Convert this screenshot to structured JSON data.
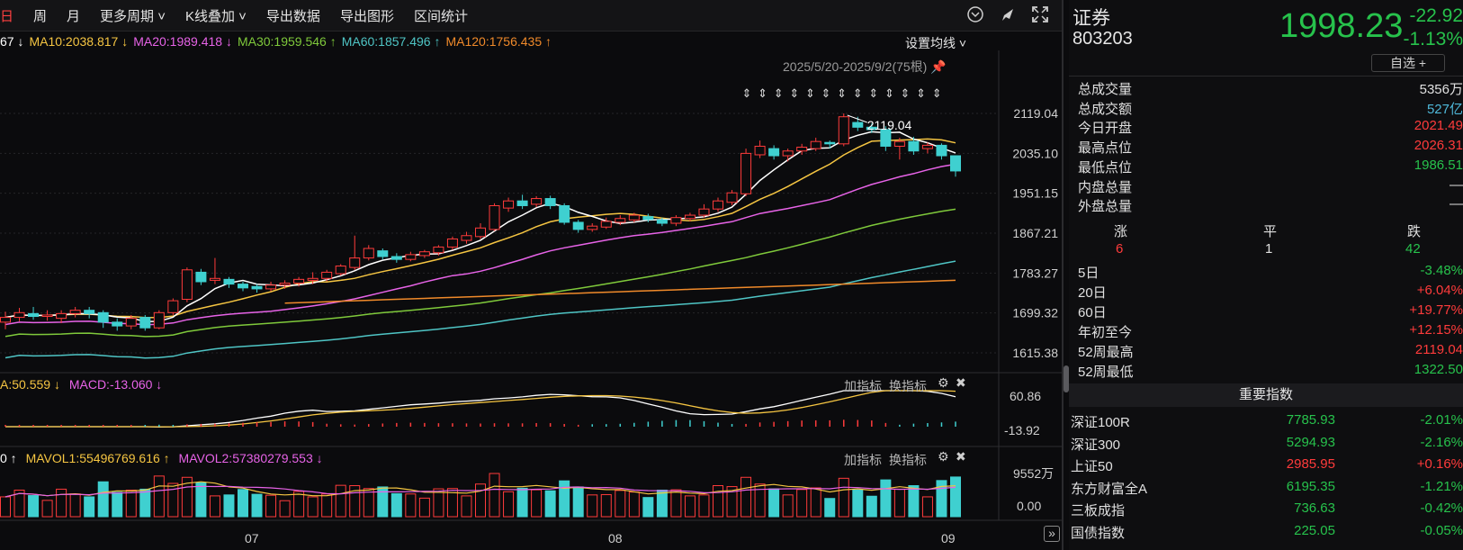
{
  "toolbar": {
    "items": [
      "日",
      "周",
      "月",
      "更多周期 ˅",
      "K线叠加 ˅",
      "导出数据",
      "导出图形",
      "区间统计"
    ]
  },
  "ma_legend": {
    "ma5": "67 ↓",
    "ma10": "MA10:2038.817 ↓",
    "ma20": "MA20:1989.418 ↓",
    "ma30": "MA30:1959.546 ↑",
    "ma60": "MA60:1857.496 ↑",
    "ma120": "MA120:1756.435 ↑",
    "set_ma": "设置均线 ˅"
  },
  "range_label": "2025/5/20-2025/9/2(75根)",
  "price_axis": [
    "2119.04",
    "2035.10",
    "1951.15",
    "1867.21",
    "1783.27",
    "1699.32",
    "1615.38"
  ],
  "high_marker": "2119.04",
  "macd": {
    "legend_a": "A:50.559 ↓",
    "legend_b": "MACD:-13.060 ↓",
    "axis_top": "60.86",
    "axis_bottom": "-13.92",
    "add_label": "加指标",
    "switch_label": "换指标"
  },
  "volume": {
    "legend_a": "0 ↑",
    "legend_b": "MAVOL1:55496769.616 ↑",
    "legend_c": "MAVOL2:57380279.553 ↓",
    "axis_top": "9552万",
    "axis_bottom": "0.00",
    "add_label": "加指标",
    "switch_label": "换指标"
  },
  "x_axis": [
    "07",
    "08",
    "09"
  ],
  "chart_data": {
    "type": "candlestick",
    "ylim": [
      1615.38,
      2119.04
    ],
    "candles": [
      [
        1680,
        1690,
        1665,
        1702
      ],
      [
        1690,
        1700,
        1682,
        1710
      ],
      [
        1698,
        1692,
        1685,
        1712
      ],
      [
        1692,
        1695,
        1683,
        1705
      ],
      [
        1688,
        1698,
        1678,
        1705
      ],
      [
        1698,
        1705,
        1690,
        1712
      ],
      [
        1705,
        1698,
        1688,
        1712
      ],
      [
        1700,
        1680,
        1668,
        1705
      ],
      [
        1680,
        1672,
        1662,
        1688
      ],
      [
        1672,
        1688,
        1665,
        1695
      ],
      [
        1690,
        1668,
        1662,
        1695
      ],
      [
        1668,
        1700,
        1665,
        1705
      ],
      [
        1700,
        1725,
        1695,
        1730
      ],
      [
        1728,
        1790,
        1722,
        1795
      ],
      [
        1785,
        1765,
        1758,
        1792
      ],
      [
        1768,
        1772,
        1760,
        1815
      ],
      [
        1770,
        1760,
        1752,
        1775
      ],
      [
        1760,
        1752,
        1745,
        1765
      ],
      [
        1755,
        1750,
        1742,
        1760
      ],
      [
        1750,
        1758,
        1745,
        1765
      ],
      [
        1758,
        1762,
        1750,
        1768
      ],
      [
        1762,
        1770,
        1755,
        1775
      ],
      [
        1768,
        1772,
        1760,
        1785
      ],
      [
        1772,
        1785,
        1766,
        1790
      ],
      [
        1782,
        1798,
        1778,
        1802
      ],
      [
        1795,
        1815,
        1790,
        1862
      ],
      [
        1815,
        1835,
        1810,
        1842
      ],
      [
        1830,
        1818,
        1812,
        1835
      ],
      [
        1818,
        1812,
        1805,
        1825
      ],
      [
        1812,
        1822,
        1808,
        1828
      ],
      [
        1820,
        1828,
        1815,
        1832
      ],
      [
        1826,
        1838,
        1820,
        1842
      ],
      [
        1838,
        1855,
        1832,
        1860
      ],
      [
        1852,
        1862,
        1845,
        1870
      ],
      [
        1860,
        1878,
        1855,
        1888
      ],
      [
        1875,
        1925,
        1872,
        1930
      ],
      [
        1920,
        1935,
        1912,
        1942
      ],
      [
        1935,
        1925,
        1918,
        1948
      ],
      [
        1928,
        1940,
        1922,
        1945
      ],
      [
        1940,
        1925,
        1918,
        1946
      ],
      [
        1925,
        1890,
        1885,
        1930
      ],
      [
        1890,
        1875,
        1868,
        1895
      ],
      [
        1875,
        1882,
        1870,
        1888
      ],
      [
        1880,
        1892,
        1876,
        1900
      ],
      [
        1890,
        1898,
        1884,
        1905
      ],
      [
        1895,
        1905,
        1890,
        1910
      ],
      [
        1902,
        1896,
        1890,
        1908
      ],
      [
        1895,
        1888,
        1882,
        1900
      ],
      [
        1888,
        1900,
        1882,
        1905
      ],
      [
        1898,
        1905,
        1892,
        1910
      ],
      [
        1905,
        1918,
        1900,
        1928
      ],
      [
        1918,
        1935,
        1912,
        1942
      ],
      [
        1932,
        1952,
        1926,
        1958
      ],
      [
        1950,
        2035,
        1945,
        2045
      ],
      [
        2032,
        2050,
        2025,
        2062
      ],
      [
        2045,
        2030,
        2022,
        2052
      ],
      [
        2030,
        2040,
        2018,
        2045
      ],
      [
        2040,
        2048,
        2032,
        2055
      ],
      [
        2045,
        2060,
        2040,
        2068
      ],
      [
        2058,
        2055,
        2045,
        2062
      ],
      [
        2055,
        2112,
        2050,
        2119
      ],
      [
        2100,
        2090,
        2082,
        2112
      ],
      [
        2090,
        2085,
        2078,
        2098
      ],
      [
        2085,
        2050,
        2040,
        2092
      ],
      [
        2050,
        2060,
        2022,
        2068
      ],
      [
        2060,
        2040,
        2032,
        2070
      ],
      [
        2045,
        2052,
        2035,
        2058
      ],
      [
        2052,
        2030,
        2022,
        2056
      ],
      [
        2030,
        1998,
        1986,
        2026
      ]
    ]
  },
  "quote": {
    "name": "证券",
    "code": "803203",
    "price": "1998.23",
    "change": "-22.92",
    "change_pct": "-1.13%",
    "watch_label": "自选 +"
  },
  "stats": [
    {
      "label": "总成交量",
      "value": "5356万",
      "tone": "wh"
    },
    {
      "label": "总成交额",
      "value": "527亿",
      "tone": "bl"
    },
    {
      "label": "今日开盘",
      "value": "2021.49",
      "tone": "up"
    },
    {
      "label": "最高点位",
      "value": "2026.31",
      "tone": "up"
    },
    {
      "label": "最低点位",
      "value": "1986.51",
      "tone": "dn"
    },
    {
      "label": "内盘总量",
      "value": "—",
      "tone": "wh"
    },
    {
      "label": "外盘总量",
      "value": "—",
      "tone": "wh"
    }
  ],
  "updown": {
    "up_label": "涨",
    "flat_label": "平",
    "down_label": "跌",
    "up_count": "6",
    "flat_count": "1",
    "down_count": "42"
  },
  "periods": [
    {
      "label": "5日",
      "value": "-3.48%",
      "tone": "dn"
    },
    {
      "label": "20日",
      "value": "+6.04%",
      "tone": "up"
    },
    {
      "label": "60日",
      "value": "+19.77%",
      "tone": "up"
    },
    {
      "label": "年初至今",
      "value": "+12.15%",
      "tone": "up"
    },
    {
      "label": "52周最高",
      "value": "2119.04",
      "tone": "up"
    },
    {
      "label": "52周最低",
      "value": "1322.50",
      "tone": "dn"
    }
  ],
  "index_title": "重要指数",
  "indices": [
    {
      "name": "深证100R",
      "price": "7785.93",
      "change": "-2.01%",
      "tone": "dn"
    },
    {
      "name": "深证300",
      "price": "5294.93",
      "change": "-2.16%",
      "tone": "dn"
    },
    {
      "name": "上证50",
      "price": "2985.95",
      "change": "+0.16%",
      "tone": "up"
    },
    {
      "name": "东方财富全A",
      "price": "6195.35",
      "change": "-1.21%",
      "tone": "dn"
    },
    {
      "name": "三板成指",
      "price": "736.63",
      "change": "-0.42%",
      "tone": "dn"
    },
    {
      "name": "国债指数",
      "price": "225.05",
      "change": "-0.05%",
      "tone": "dn"
    }
  ]
}
